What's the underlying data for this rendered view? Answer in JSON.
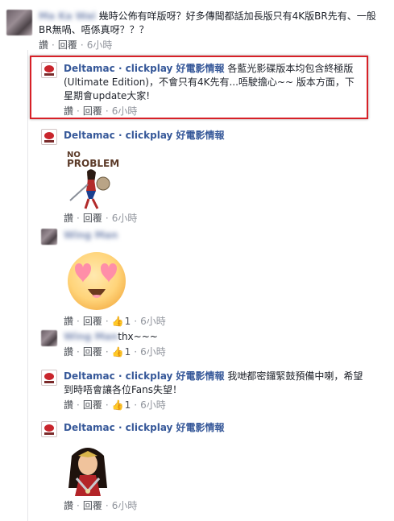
{
  "thread": {
    "top_comment": {
      "name": "Ma Ka Wai",
      "text": "幾時公佈有咩版呀？好多傳聞都話加長版只有4K版BR先有、一般BR無喎、唔係真呀？？？",
      "actions": {
        "like": "讚",
        "reply": "回覆",
        "time": "6小時"
      }
    },
    "replies": [
      {
        "name": "Deltamac · clickplay 好電影情報",
        "text": "各藍光影碟版本均包含終極版(Ultimate Edition)，不會只有4K先有...唔駛擔心~~ 版本方面，下星期會update大家!",
        "actions": {
          "like": "讚",
          "reply": "回覆",
          "time": "6小時"
        }
      },
      {
        "name": "Deltamac · clickplay 好電影情報",
        "sticker": {
          "text_line1": "NO",
          "text_line2": "PROBLEM"
        },
        "actions": {
          "like": "讚",
          "reply": "回覆",
          "time": "6小時"
        }
      },
      {
        "name": "Wing Man",
        "actions": {
          "like": "讚",
          "reply": "回覆",
          "likes": "1",
          "time": "6小時"
        }
      },
      {
        "name": "Wing Man",
        "text": "thx~~~",
        "actions": {
          "like": "讚",
          "reply": "回覆",
          "likes": "1",
          "time": "6小時"
        }
      },
      {
        "name": "Deltamac · clickplay 好電影情報",
        "text": "我哋都密鑼緊鼓預備中喇，希望到時唔會讓各位Fans失望！",
        "actions": {
          "like": "讚",
          "reply": "回覆",
          "likes": "1",
          "time": "6小時"
        }
      },
      {
        "name": "Deltamac · clickplay 好電影情報",
        "actions": {
          "like": "讚",
          "reply": "回覆",
          "time": "6小時"
        }
      }
    ]
  },
  "colors": {
    "link": "#365899",
    "highlight": "#d72027",
    "meta": "#90949c",
    "like": "#4267b2"
  }
}
